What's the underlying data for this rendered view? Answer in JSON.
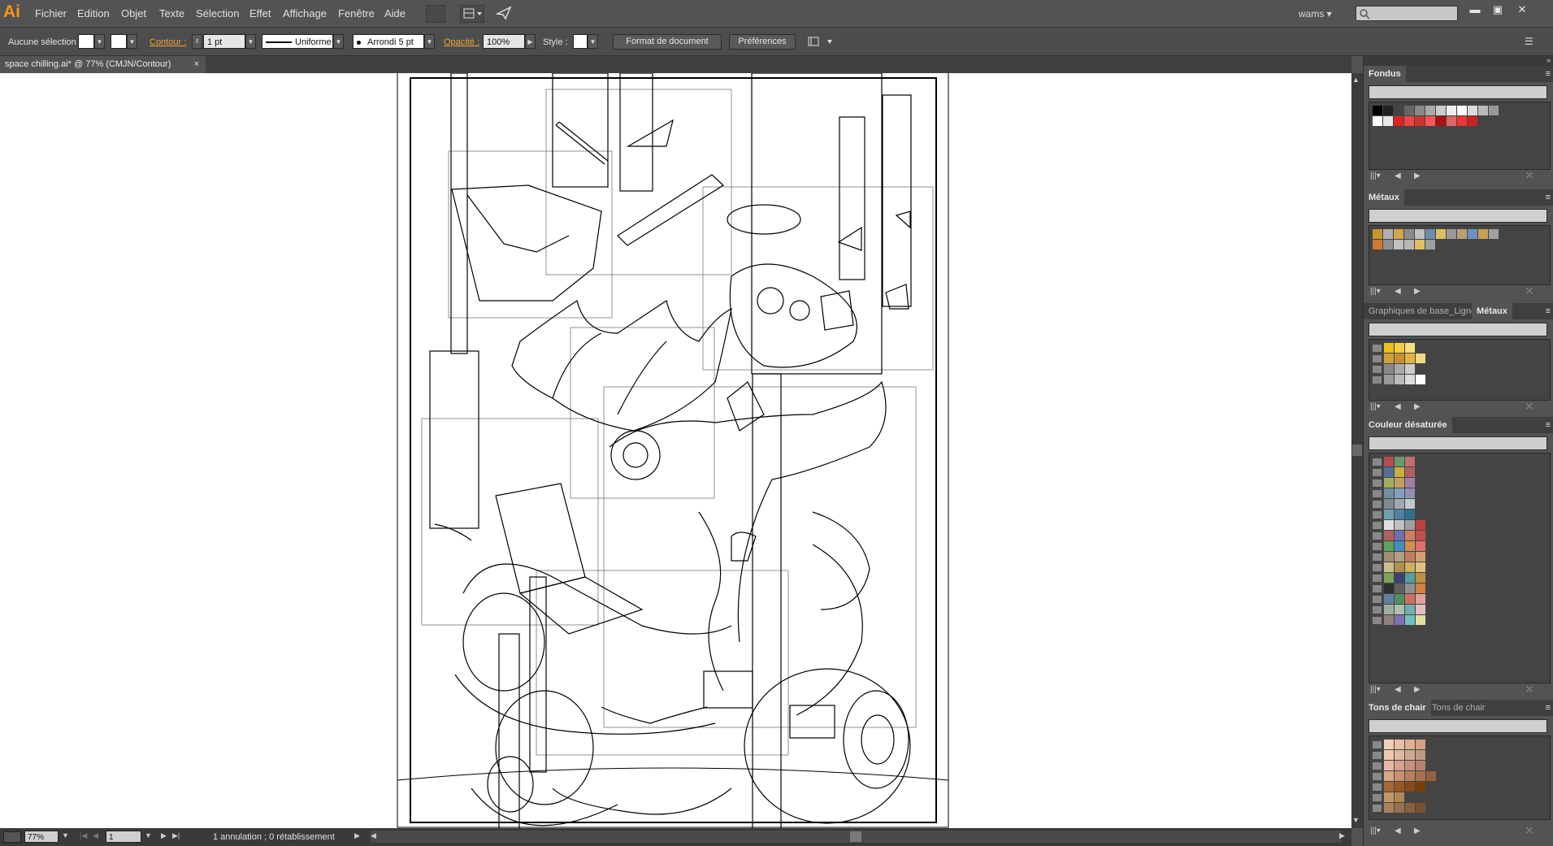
{
  "app": {
    "logo": "Ai"
  },
  "menu": [
    "Fichier",
    "Edition",
    "Objet",
    "Texte",
    "Sélection",
    "Effet",
    "Affichage",
    "Fenêtre",
    "Aide"
  ],
  "user": "wams",
  "control": {
    "selection": "Aucune sélection",
    "stroke_label": "Contour :",
    "stroke_value": "1 pt",
    "stroke_profile": "Uniforme",
    "brush": "Arrondi 5 pt",
    "opacity_label": "Opacité :",
    "opacity_value": "100%",
    "style_label": "Style :",
    "doc_format_btn": "Format de document",
    "prefs_btn": "Préférences"
  },
  "document": {
    "tab_title": "space chilling.ai* @ 77% (CMJN/Contour)",
    "close": "×"
  },
  "status": {
    "zoom": "77%",
    "artboard": "1",
    "history": "1 annulation ; 0 rétablissement"
  },
  "panels": {
    "fondus": {
      "title": "Fondus"
    },
    "metaux": {
      "title": "Métaux"
    },
    "graphiques": {
      "tab1": "Graphiques de base_Lignes",
      "tab2": "Métaux"
    },
    "desaturee": {
      "title": "Couleur désaturée"
    },
    "chair": {
      "tab1": "Tons de chair",
      "tab2": "Tons de chair"
    }
  },
  "colors": {
    "accent": "#f7961d",
    "link": "#f2a43a",
    "ui_bg": "#535353"
  }
}
